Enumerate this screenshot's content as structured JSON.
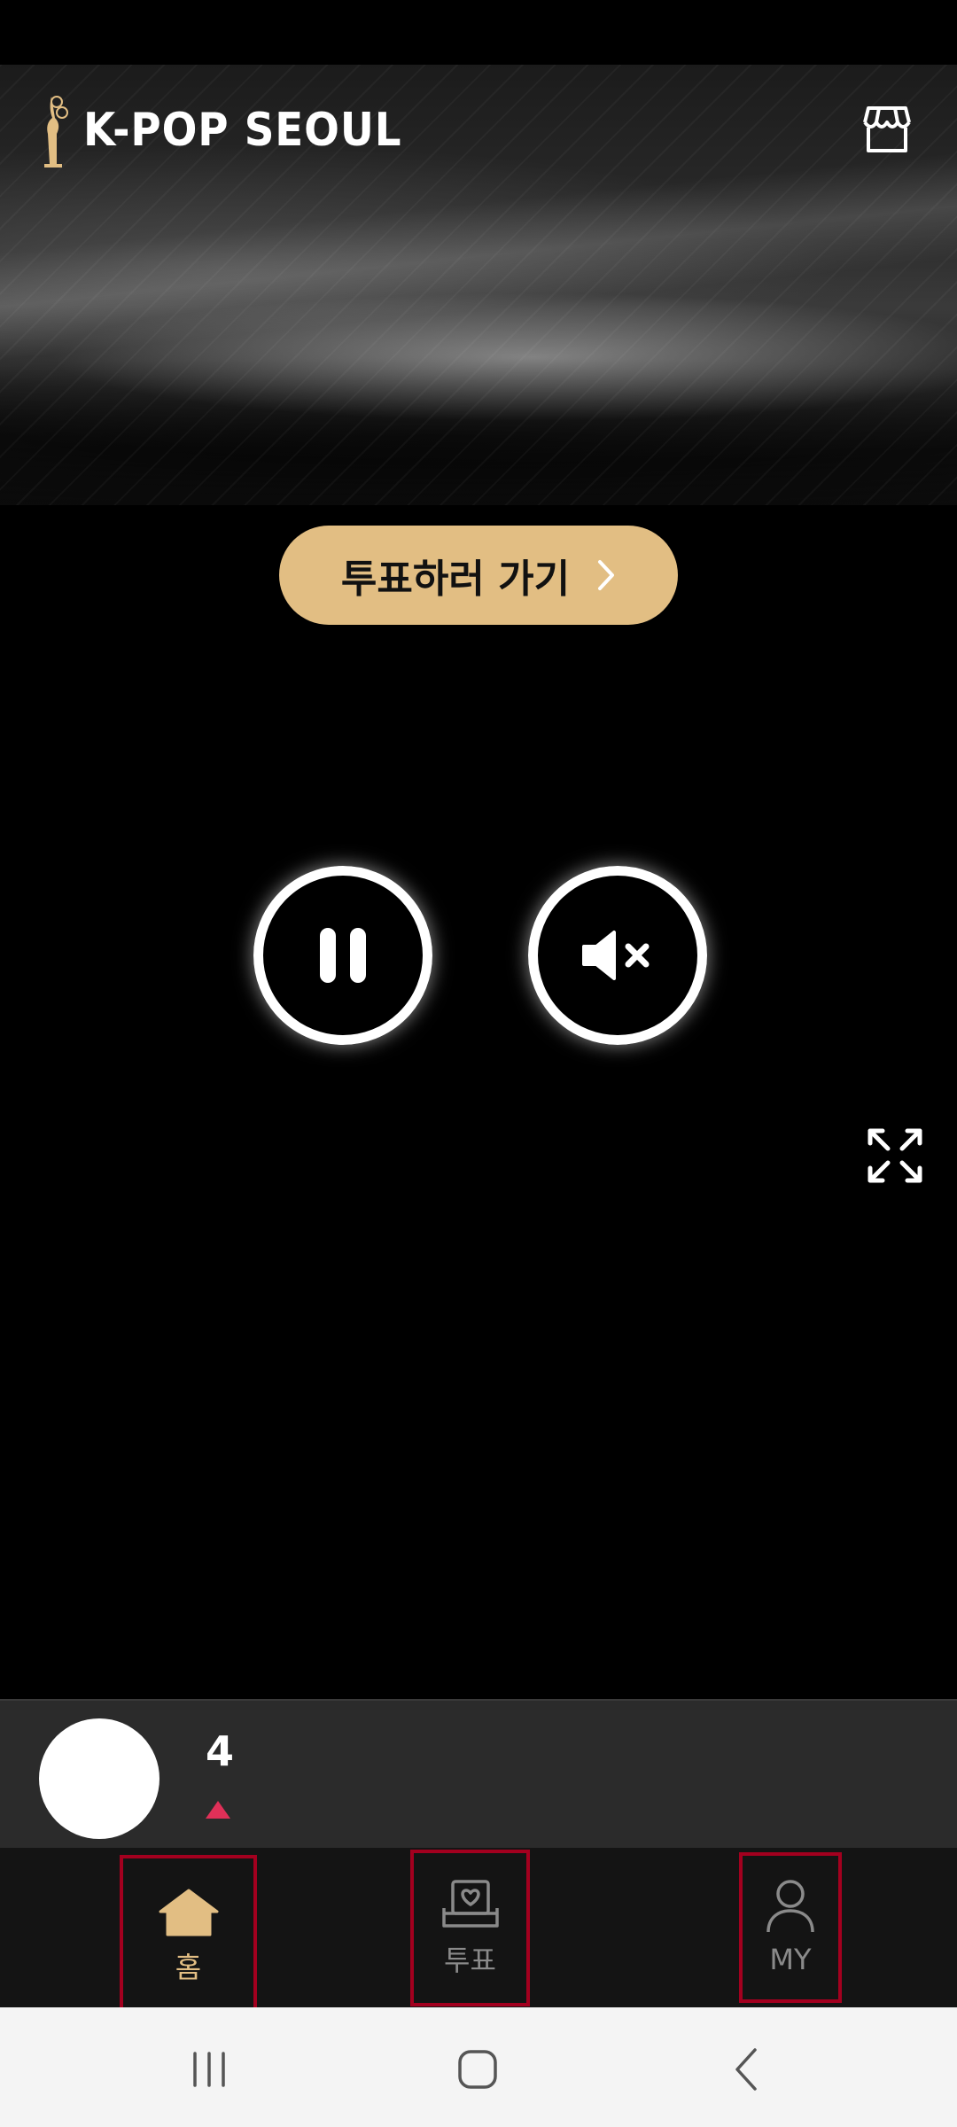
{
  "app": {
    "logo_text": "K-POP SEOUL"
  },
  "header": {
    "store_icon": "store-icon"
  },
  "vote_cta": {
    "label": "투표하러 가기",
    "icon": "chevron-right-icon"
  },
  "player": {
    "pause_icon": "pause-icon",
    "mute_icon": "volume-mute-icon",
    "fullscreen_icon": "expand-icon"
  },
  "user_rank": {
    "rank": "4",
    "trend": "up",
    "trend_color": "#e03058"
  },
  "bottom_nav": {
    "items": [
      {
        "label": "홈",
        "icon": "home-icon",
        "active": true
      },
      {
        "label": "투표",
        "icon": "vote-box-icon",
        "active": false
      },
      {
        "label": "MY",
        "icon": "user-icon",
        "active": false
      }
    ]
  },
  "colors": {
    "accent": "#e2be83",
    "highlight_border": "#a3001f",
    "background": "#000000"
  }
}
